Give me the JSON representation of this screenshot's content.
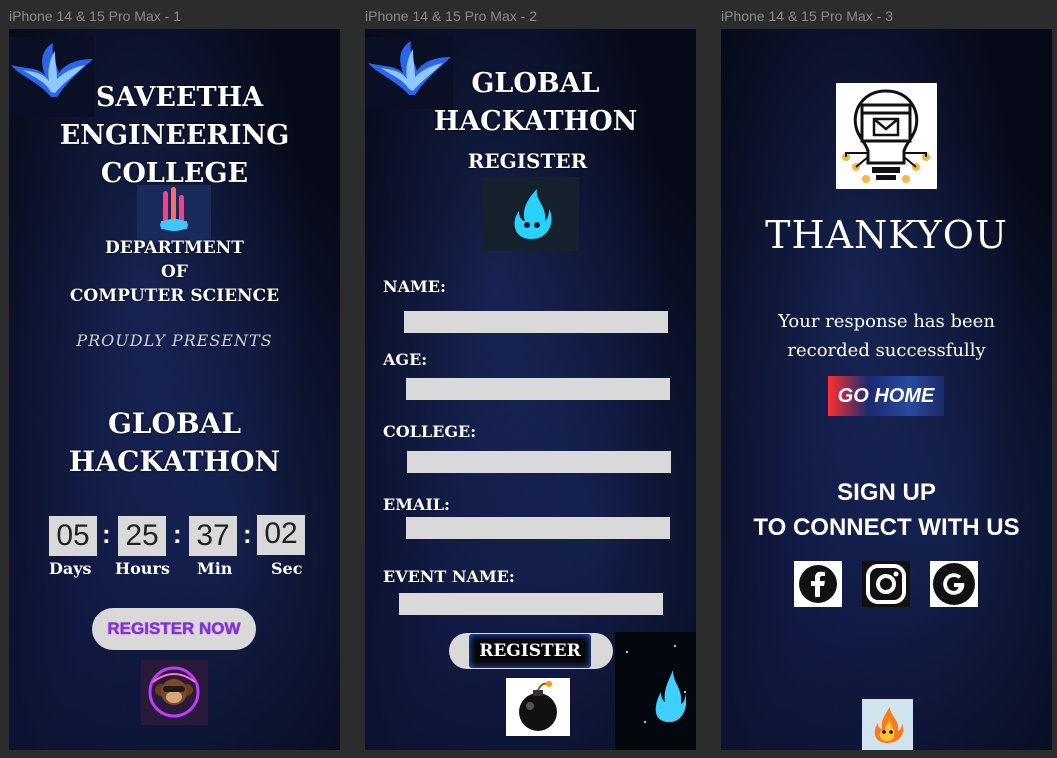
{
  "frames": [
    {
      "label": "iPhone 14 & 15 Pro Max - 1"
    },
    {
      "label": "iPhone 14 & 15 Pro Max - 2"
    },
    {
      "label": "iPhone 14 & 15 Pro Max - 3"
    }
  ],
  "screen1": {
    "college_line1": "SAVEETHA",
    "college_line2": "ENGINEERING",
    "college_line3": "COLLEGE",
    "dept_line1": "DEPARTMENT",
    "dept_line2": "OF",
    "dept_line3": "COMPUTER SCIENCE",
    "presents": "PROUDLY PRESENTS",
    "event_line1": "GLOBAL",
    "event_line2": "HACKATHON",
    "countdown": {
      "days": "05",
      "hours": "25",
      "min": "37",
      "sec": "02",
      "days_label": "Days",
      "hours_label": "Hours",
      "min_label": "Min",
      "sec_label": "Sec",
      "separator": ":"
    },
    "register_button": "REGISTER NOW"
  },
  "screen2": {
    "title_line1": "GLOBAL",
    "title_line2": "HACKATHON",
    "subtitle": "REGISTER",
    "fields": {
      "name": "NAME:",
      "age": "AGE:",
      "college": "COLLEGE:",
      "email": "EMAIL:",
      "event_name": "EVENT NAME:"
    },
    "register_button": "REGISTER"
  },
  "screen3": {
    "thankyou": "THANKYOU",
    "message": "Your response has been recorded successfully",
    "go_home_button": "GO HOME",
    "signup_line1": "SIGN UP",
    "signup_line2": "TO CONNECT WITH US",
    "social": {
      "facebook": "f",
      "google": "G"
    }
  },
  "colors": {
    "field_gray": "#d9d9d9",
    "register_now_text": "#8a2be2",
    "background": "#070a18"
  },
  "icons": [
    "phoenix-logo-icon",
    "gradient-logo-icon",
    "monkey-avatar-icon",
    "blue-flame-icon",
    "bomb-icon",
    "idea-bulb-icon",
    "facebook-icon",
    "instagram-icon",
    "google-icon",
    "fire-mascot-icon"
  ]
}
